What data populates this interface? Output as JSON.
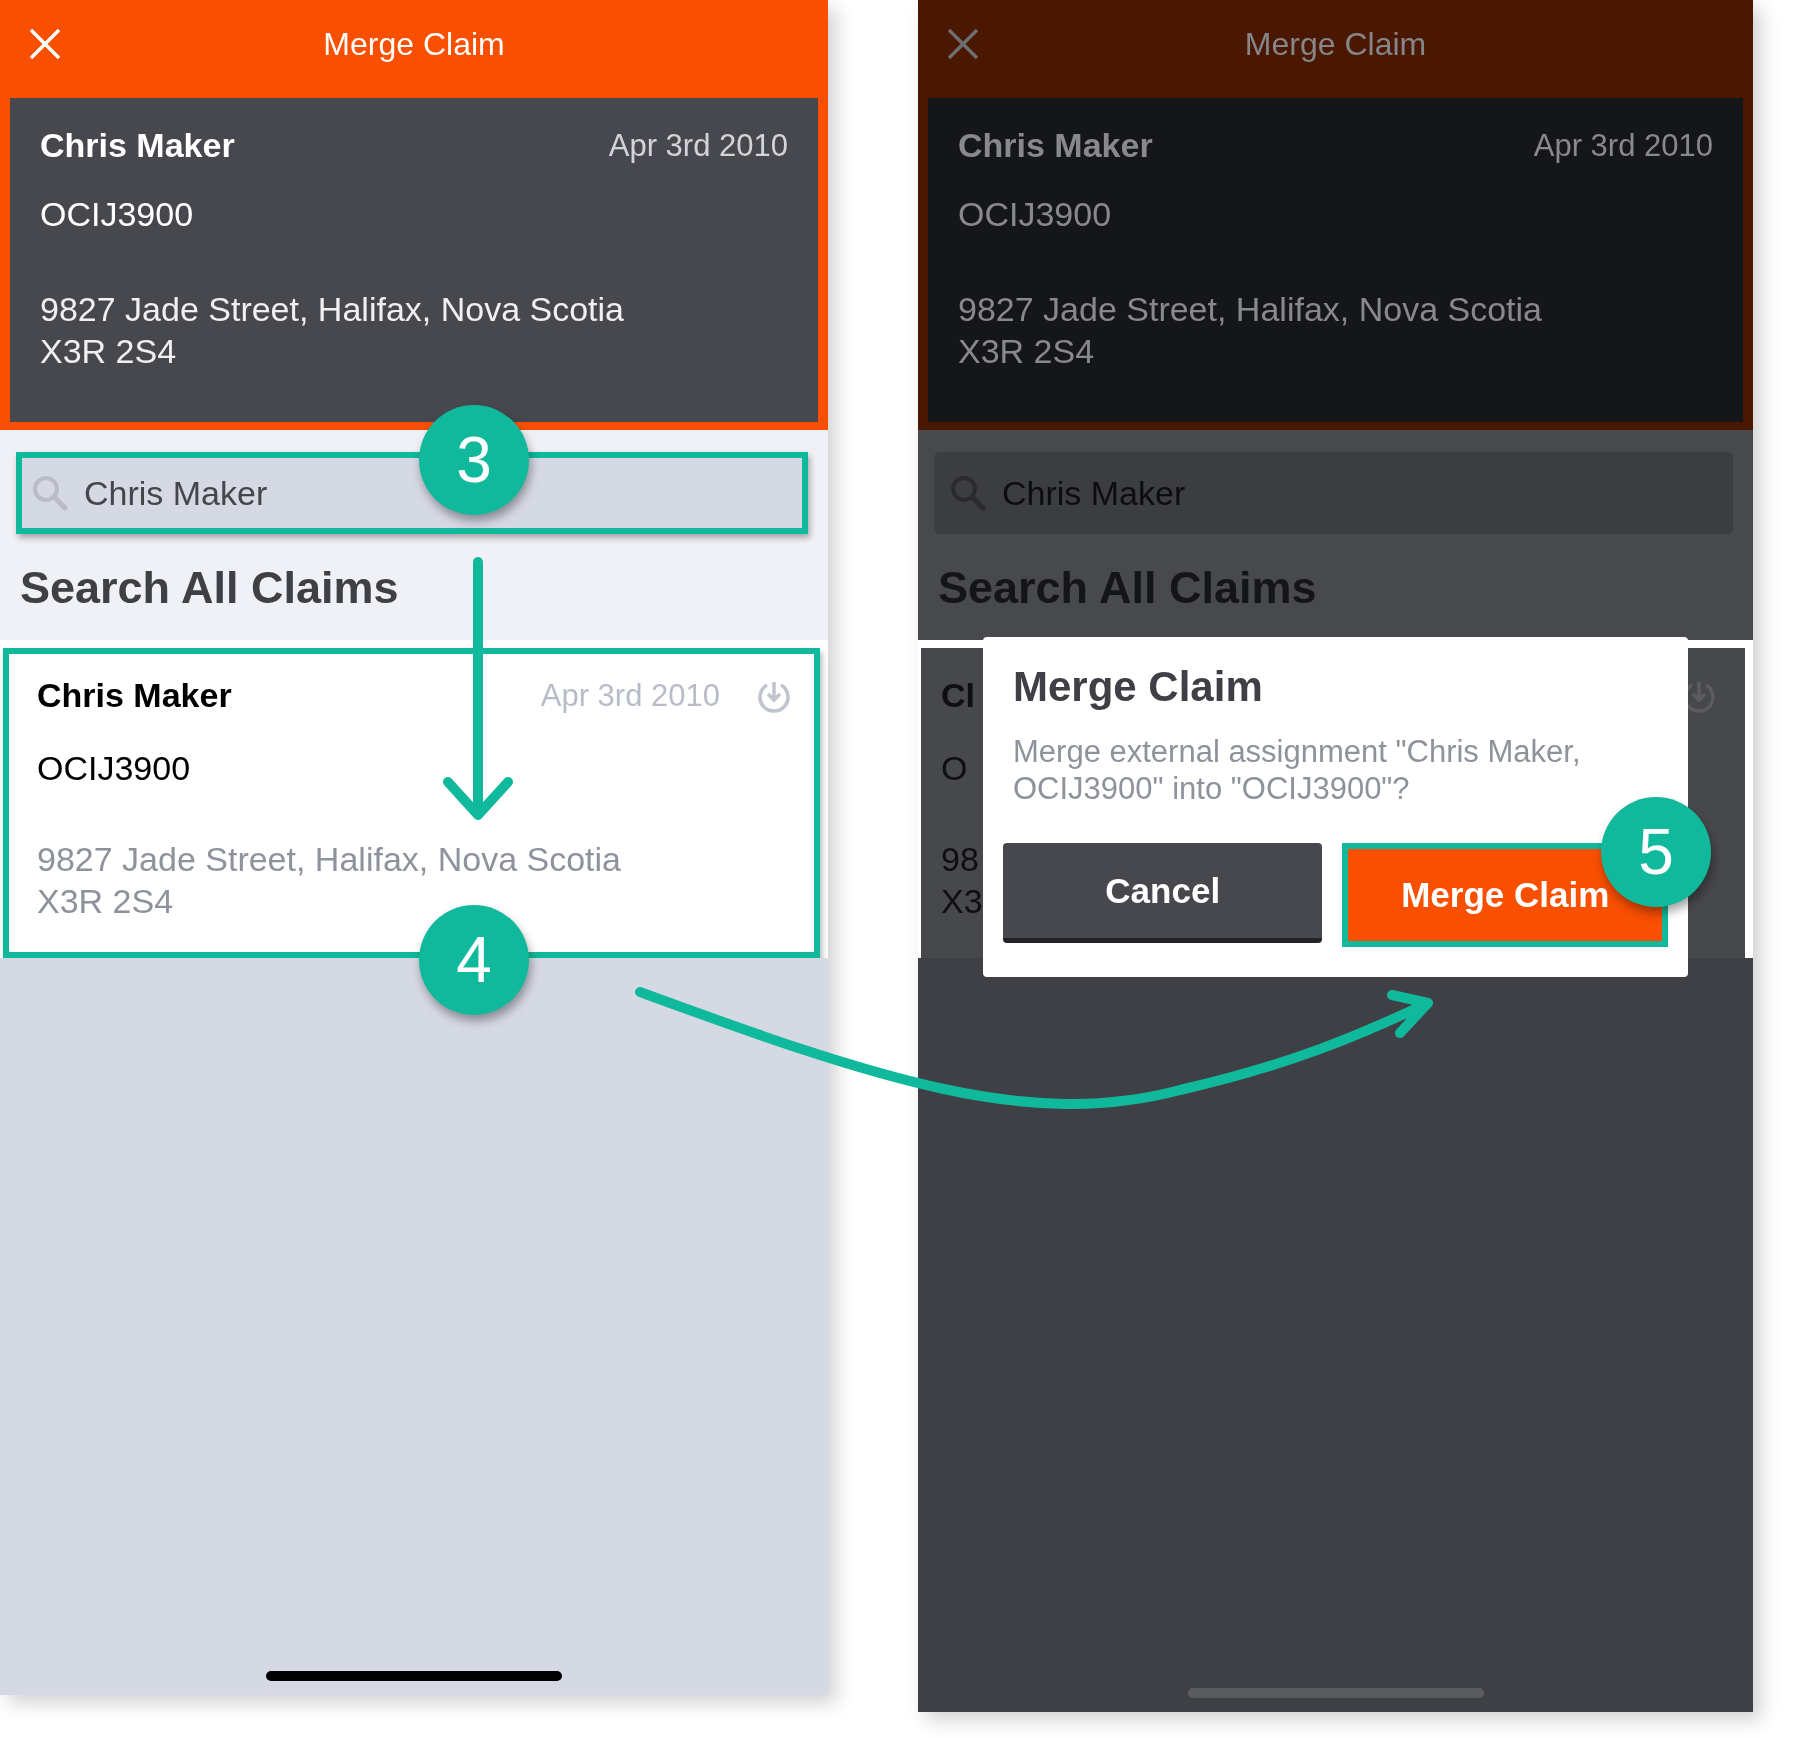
{
  "screens": [
    {
      "dimmed": false,
      "header": {
        "title": "Merge Claim"
      },
      "selected_claim": {
        "name": "Chris Maker",
        "date": "Apr 3rd 2010",
        "id": "OCIJ3900",
        "address": [
          "9827 Jade Street, Halifax, Nova Scotia",
          "X3R 2S4"
        ]
      },
      "search": {
        "value": "Chris Maker",
        "highlighted": true
      },
      "section_title": "Search All Claims",
      "result": {
        "highlighted": true,
        "name": "Chris Maker",
        "date": "Apr 3rd 2010",
        "id": "OCIJ3900",
        "address": [
          "9827 Jade Street, Halifax, Nova Scotia",
          "X3R 2S4"
        ]
      }
    },
    {
      "dimmed": true,
      "header": {
        "title": "Merge Claim"
      },
      "selected_claim": {
        "name": "Chris Maker",
        "date": "Apr 3rd 2010",
        "id": "OCIJ3900",
        "address": [
          "9827 Jade Street, Halifax, Nova Scotia",
          "X3R 2S4"
        ]
      },
      "search": {
        "value": "Chris Maker",
        "highlighted": false
      },
      "section_title": "Search All Claims",
      "result": {
        "highlighted": false,
        "name": "Cl",
        "id": "O",
        "address": [
          "98",
          "X3"
        ]
      }
    }
  ],
  "dialog": {
    "title": "Merge Claim",
    "message": "Merge external assignment \"Chris Maker, OCIJ3900\" into \"OCIJ3900\"?",
    "cancel": "Cancel",
    "confirm": {
      "label": "Merge Claim",
      "highlighted": true
    }
  },
  "steps": [
    {
      "label": "3"
    },
    {
      "label": "4"
    },
    {
      "label": "5"
    }
  ]
}
